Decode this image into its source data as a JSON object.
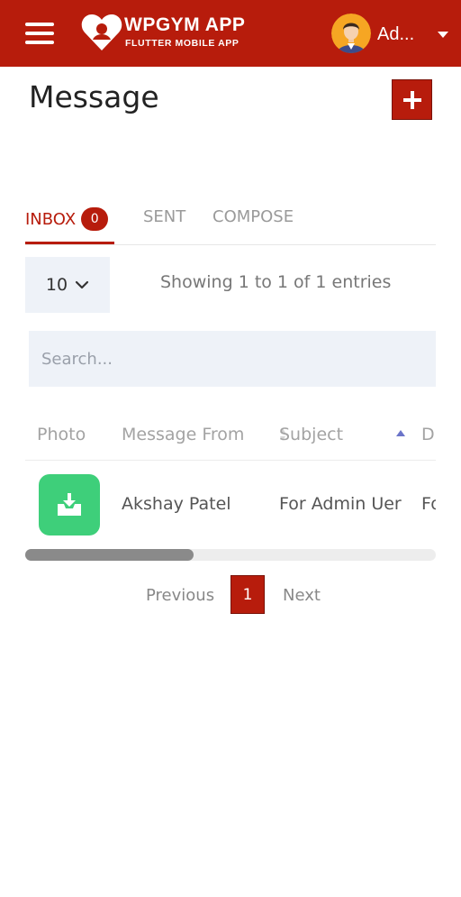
{
  "header": {
    "brand_name": "WPGYM APP",
    "brand_subtitle": "FLUTTER MOBILE APP",
    "user_name": "Ad...",
    "menu_icon": "hamburger-menu-icon",
    "logo_icon": "heart-logo-icon",
    "dropdown_icon": "caret-down-icon",
    "accent_color": "#b71c0c"
  },
  "page": {
    "title": "Message",
    "add_icon": "plus-icon"
  },
  "tabs": [
    {
      "label": "INBOX",
      "badge": "0",
      "active": true
    },
    {
      "label": "SENT",
      "active": false
    },
    {
      "label": "COMPOSE",
      "active": false
    }
  ],
  "table_controls": {
    "page_length": "10",
    "info": "Showing 1 to 1 of 1 entries",
    "search_placeholder": "Search..."
  },
  "table": {
    "columns": [
      "Photo",
      "Message From",
      "Subject",
      "D"
    ],
    "rows": [
      {
        "photo_icon": "inbox-download-icon",
        "from": "Akshay Patel",
        "subject": "For Admin Uer",
        "extra": "Fo"
      }
    ],
    "photo_color": "#3ecf7a"
  },
  "pagination": {
    "previous": "Previous",
    "current": "1",
    "next": "Next"
  }
}
